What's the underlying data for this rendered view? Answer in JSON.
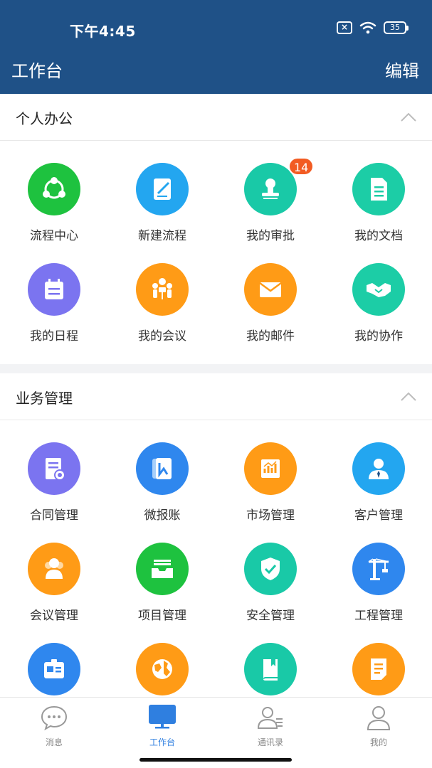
{
  "status": {
    "time": "下午4:45",
    "battery": "35"
  },
  "nav": {
    "title": "工作台",
    "edit": "编辑"
  },
  "sections": [
    {
      "title": "个人办公",
      "items": [
        {
          "label": "流程中心",
          "icon": "share-nodes-icon",
          "color": "#1ec23f"
        },
        {
          "label": "新建流程",
          "icon": "edit-document-icon",
          "color": "#23a6f0"
        },
        {
          "label": "我的审批",
          "icon": "stamp-icon",
          "color": "#19c9a7",
          "badge": "14"
        },
        {
          "label": "我的文档",
          "icon": "document-icon",
          "color": "#1ccda6"
        },
        {
          "label": "我的日程",
          "icon": "calendar-icon",
          "color": "#7b74f0"
        },
        {
          "label": "我的会议",
          "icon": "meeting-icon",
          "color": "#ff9b16"
        },
        {
          "label": "我的邮件",
          "icon": "mail-icon",
          "color": "#ff9b16"
        },
        {
          "label": "我的协作",
          "icon": "handshake-icon",
          "color": "#1ccda6"
        }
      ]
    },
    {
      "title": "业务管理",
      "items": [
        {
          "label": "合同管理",
          "icon": "contract-icon",
          "color": "#7b74f0"
        },
        {
          "label": "微报账",
          "icon": "expense-icon",
          "color": "#2f87ee"
        },
        {
          "label": "市场管理",
          "icon": "market-chart-icon",
          "color": "#ff9b16"
        },
        {
          "label": "客户管理",
          "icon": "customer-icon",
          "color": "#23a6f0"
        },
        {
          "label": "会议管理",
          "icon": "people-icon",
          "color": "#ff9b16"
        },
        {
          "label": "项目管理",
          "icon": "tray-icon",
          "color": "#1ec23f"
        },
        {
          "label": "安全管理",
          "icon": "shield-check-icon",
          "color": "#19c9a7"
        },
        {
          "label": "工程管理",
          "icon": "crane-icon",
          "color": "#2f87ee"
        },
        {
          "label": "",
          "icon": "id-card-icon",
          "color": "#2f87ee"
        },
        {
          "label": "",
          "icon": "globe-icon",
          "color": "#ff9b16"
        },
        {
          "label": "",
          "icon": "book-icon",
          "color": "#19c9a7"
        },
        {
          "label": "",
          "icon": "notes-icon",
          "color": "#ff9b16"
        }
      ]
    }
  ],
  "tabs": [
    {
      "label": "消息",
      "icon": "chat-bubble-icon",
      "active": false
    },
    {
      "label": "工作台",
      "icon": "monitor-icon",
      "active": true
    },
    {
      "label": "通讯录",
      "icon": "contacts-icon",
      "active": false
    },
    {
      "label": "我的",
      "icon": "profile-icon",
      "active": false
    }
  ],
  "colors": {
    "header": "#1f5187",
    "active_tab": "#2f7fe0",
    "badge": "#f25b22"
  }
}
